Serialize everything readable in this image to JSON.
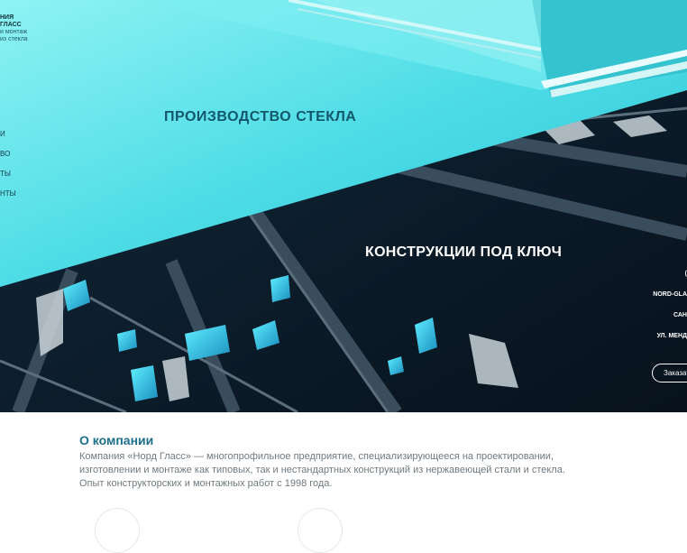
{
  "brand": {
    "name": "НИЯ\nГЛАСС",
    "tagline": "и монтаж\nиз стекла"
  },
  "nav": {
    "items": [
      "И",
      "ВО",
      "ТЫ",
      "НТЫ"
    ]
  },
  "hero": {
    "slide1_title": "ПРОИЗВОДСТВО СТЕКЛА",
    "slide2_title": "КОНСТРУКЦИИ ПОД КЛЮЧ"
  },
  "contacts": {
    "line1": "(",
    "line2": "NORD-GLA",
    "line3": "САН",
    "line4": "УЛ. МЕНД",
    "order_button": "Заказат"
  },
  "about": {
    "title": "О компании",
    "text": "Компания «Норд Гласс» — многопрофильное предприятие, специализирующееся на проектировании, изготовлении и монтаже как типовых, так и нестандартных конструкций из нержавеющей стали и стекла. Опыт конструкторских и монтажных работ с 1998 года."
  },
  "colors": {
    "teal_light": "#6ee8ee",
    "teal_dark": "#2bc4cf",
    "navy": "#0d1b26",
    "accent_text": "#1d6f8c"
  }
}
